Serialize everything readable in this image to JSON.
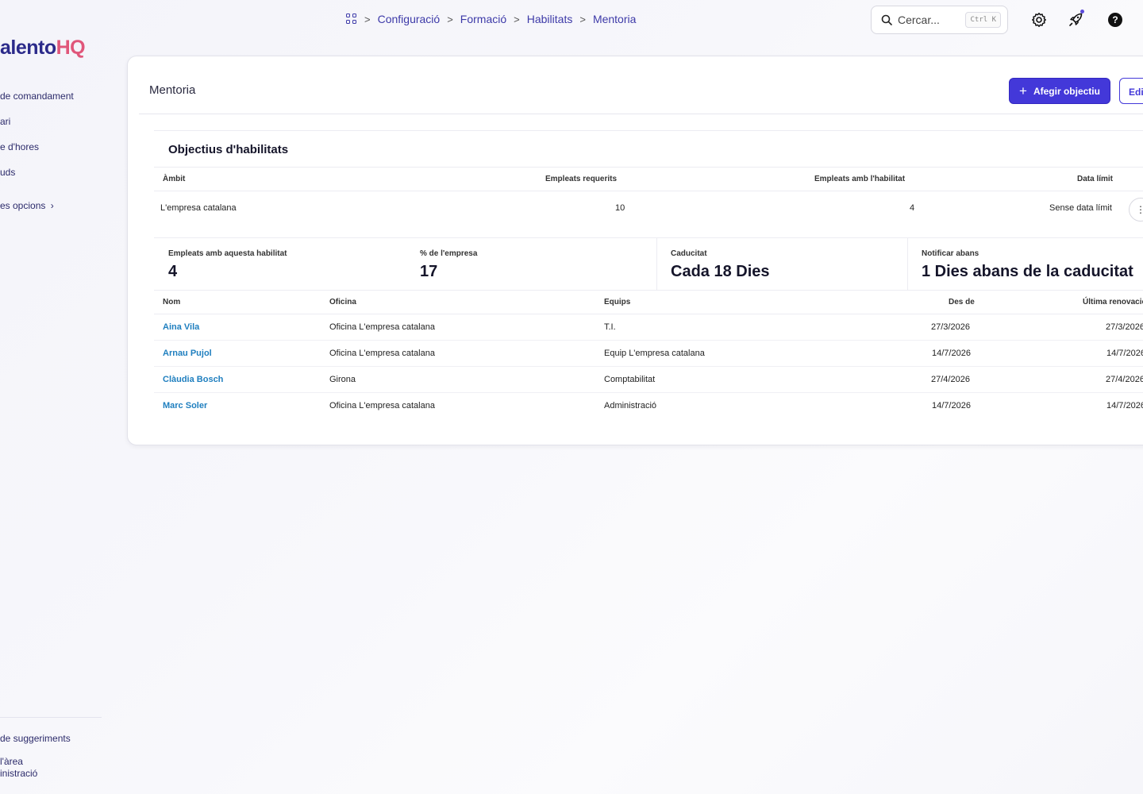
{
  "brand": {
    "part1": "alento",
    "part2": "HQ"
  },
  "sidebar": {
    "items": [
      {
        "label": "de comandament"
      },
      {
        "label": "ari"
      },
      {
        "label": "e d'hores"
      },
      {
        "label": "uds"
      }
    ],
    "more_label": "es opcions",
    "bottom": [
      {
        "label": "de suggeriments"
      },
      {
        "label": "l'àrea inistració"
      }
    ]
  },
  "breadcrumb": {
    "items": [
      "Configuració",
      "Formació",
      "Habilitats",
      "Mentoria"
    ]
  },
  "search": {
    "placeholder": "Cercar...",
    "shortcut": "Ctrl K"
  },
  "header": {
    "title": "Mentoria",
    "add_button": "Afegir objectiu",
    "edit_button": "Editar"
  },
  "goals": {
    "title": "Objectius d'habilitats",
    "columns": [
      "Àmbit",
      "Empleats requerits",
      "Empleats amb l'habilitat",
      "Data límit"
    ],
    "row": {
      "scope": "L'empresa catalana",
      "required": "10",
      "with_skill": "4",
      "deadline": "Sense data límit"
    }
  },
  "stats": [
    {
      "label": "Empleats amb aquesta habilitat",
      "value": "4"
    },
    {
      "label": "% de l'empresa",
      "value": "17"
    },
    {
      "label": "Caducitat",
      "value": "Cada 18 Dies"
    },
    {
      "label": "Notificar abans",
      "value": "1 Dies abans de la caducitat"
    }
  ],
  "employees": {
    "columns": [
      "Nom",
      "Oficina",
      "Equips",
      "Des de",
      "Última renovació"
    ],
    "rows": [
      {
        "name": "Aina Vila",
        "office": "Oficina L'empresa catalana",
        "team": "T.I.",
        "since": "27/3/2026",
        "renewal": "27/3/2026"
      },
      {
        "name": "Arnau Pujol",
        "office": "Oficina L'empresa catalana",
        "team": "Equip L'empresa catalana",
        "since": "14/7/2026",
        "renewal": "14/7/2026"
      },
      {
        "name": "Clàudia Bosch",
        "office": "Girona",
        "team": "Comptabilitat",
        "since": "27/4/2026",
        "renewal": "27/4/2026"
      },
      {
        "name": "Marc Soler",
        "office": "Oficina L'empresa catalana",
        "team": "Administració",
        "since": "14/7/2026",
        "renewal": "14/7/2026"
      }
    ]
  },
  "colors": {
    "accent": "#4338d9",
    "link": "#1f7fbf",
    "brand_dark": "#2b2a8a",
    "brand_pink": "#e0567a"
  }
}
